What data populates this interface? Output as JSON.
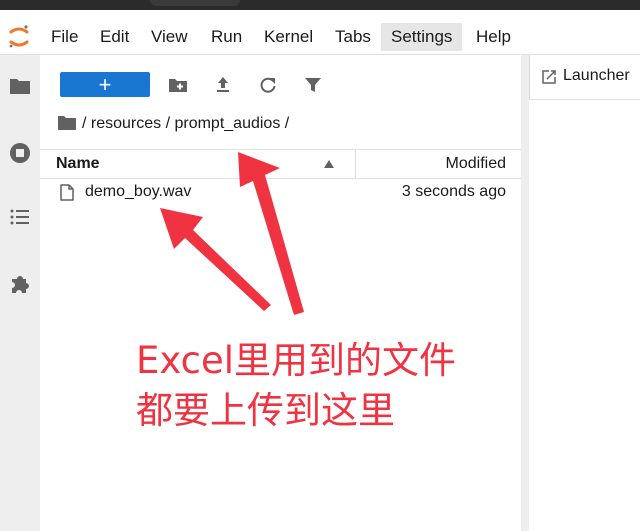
{
  "menubar": {
    "items": [
      "File",
      "Edit",
      "View",
      "Run",
      "Kernel",
      "Tabs",
      "Settings",
      "Help"
    ],
    "active": "Settings"
  },
  "leftbar": {
    "icons": [
      "folder-icon",
      "running-icon",
      "toc-icon",
      "extension-icon"
    ]
  },
  "toolbar": {
    "new_label": "+",
    "icons": [
      "new-folder-icon",
      "upload-icon",
      "refresh-icon",
      "filter-icon"
    ]
  },
  "breadcrumb": {
    "path": "/ resources / prompt_audios /"
  },
  "file_table": {
    "columns": [
      "Name",
      "Modified"
    ],
    "rows": [
      {
        "name": "demo_boy.wav",
        "modified": "3 seconds ago"
      }
    ]
  },
  "launcher_tab": {
    "label": "Launcher"
  },
  "annotation": {
    "line1": "Excel里用到的文件",
    "line2": "都要上传到这里",
    "color": "#ef3340"
  },
  "colors": {
    "accent": "#1976d2",
    "logo": "#f37726"
  }
}
